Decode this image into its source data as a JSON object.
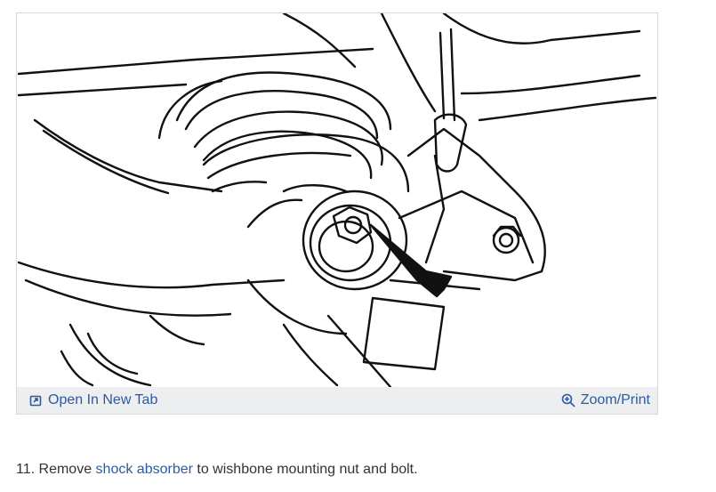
{
  "figure": {
    "open_tab_label": "Open In New Tab",
    "zoom_label": "Zoom/Print",
    "open_tab_icon": "open-new-tab-icon",
    "zoom_icon": "zoom-magnifier-icon"
  },
  "instruction": {
    "number": "11.",
    "text_before": "Remove",
    "link_text": "shock absorber",
    "text_after": "to wishbone mounting nut and bolt."
  },
  "colors": {
    "link": "#2c5aa0",
    "toolbar_bg": "#eceef0",
    "text": "#333333"
  }
}
